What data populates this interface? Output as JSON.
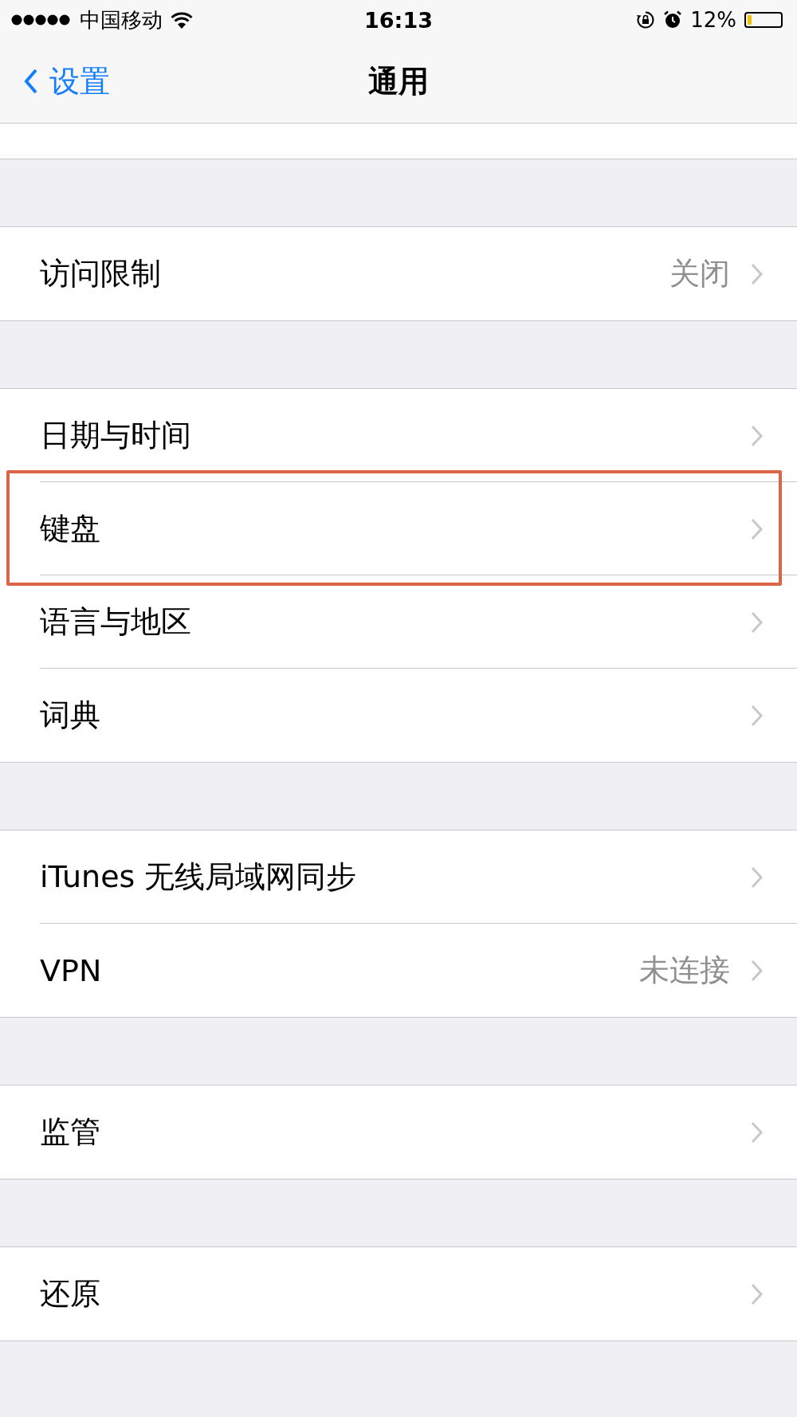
{
  "status_bar": {
    "carrier": "中国移动",
    "time": "16:13",
    "battery_text": "12%",
    "battery": {
      "level": 0.12
    }
  },
  "nav_bar": {
    "back_label": "设置",
    "title": "通用"
  },
  "groups": [
    {
      "rows": [
        {
          "label": "访问限制",
          "value": "关闭",
          "highlighted": false
        }
      ]
    },
    {
      "rows": [
        {
          "label": "日期与时间",
          "highlighted": false
        },
        {
          "label": "键盘",
          "highlighted": true
        },
        {
          "label": "语言与地区",
          "highlighted": false
        },
        {
          "label": "词典",
          "highlighted": false
        }
      ]
    },
    {
      "rows": [
        {
          "label": "iTunes 无线局域网同步",
          "highlighted": false
        },
        {
          "label": "VPN",
          "value": "未连接",
          "highlighted": false
        }
      ]
    },
    {
      "rows": [
        {
          "label": "监管",
          "highlighted": false
        }
      ]
    },
    {
      "rows": [
        {
          "label": "还原",
          "highlighted": false
        }
      ]
    }
  ]
}
